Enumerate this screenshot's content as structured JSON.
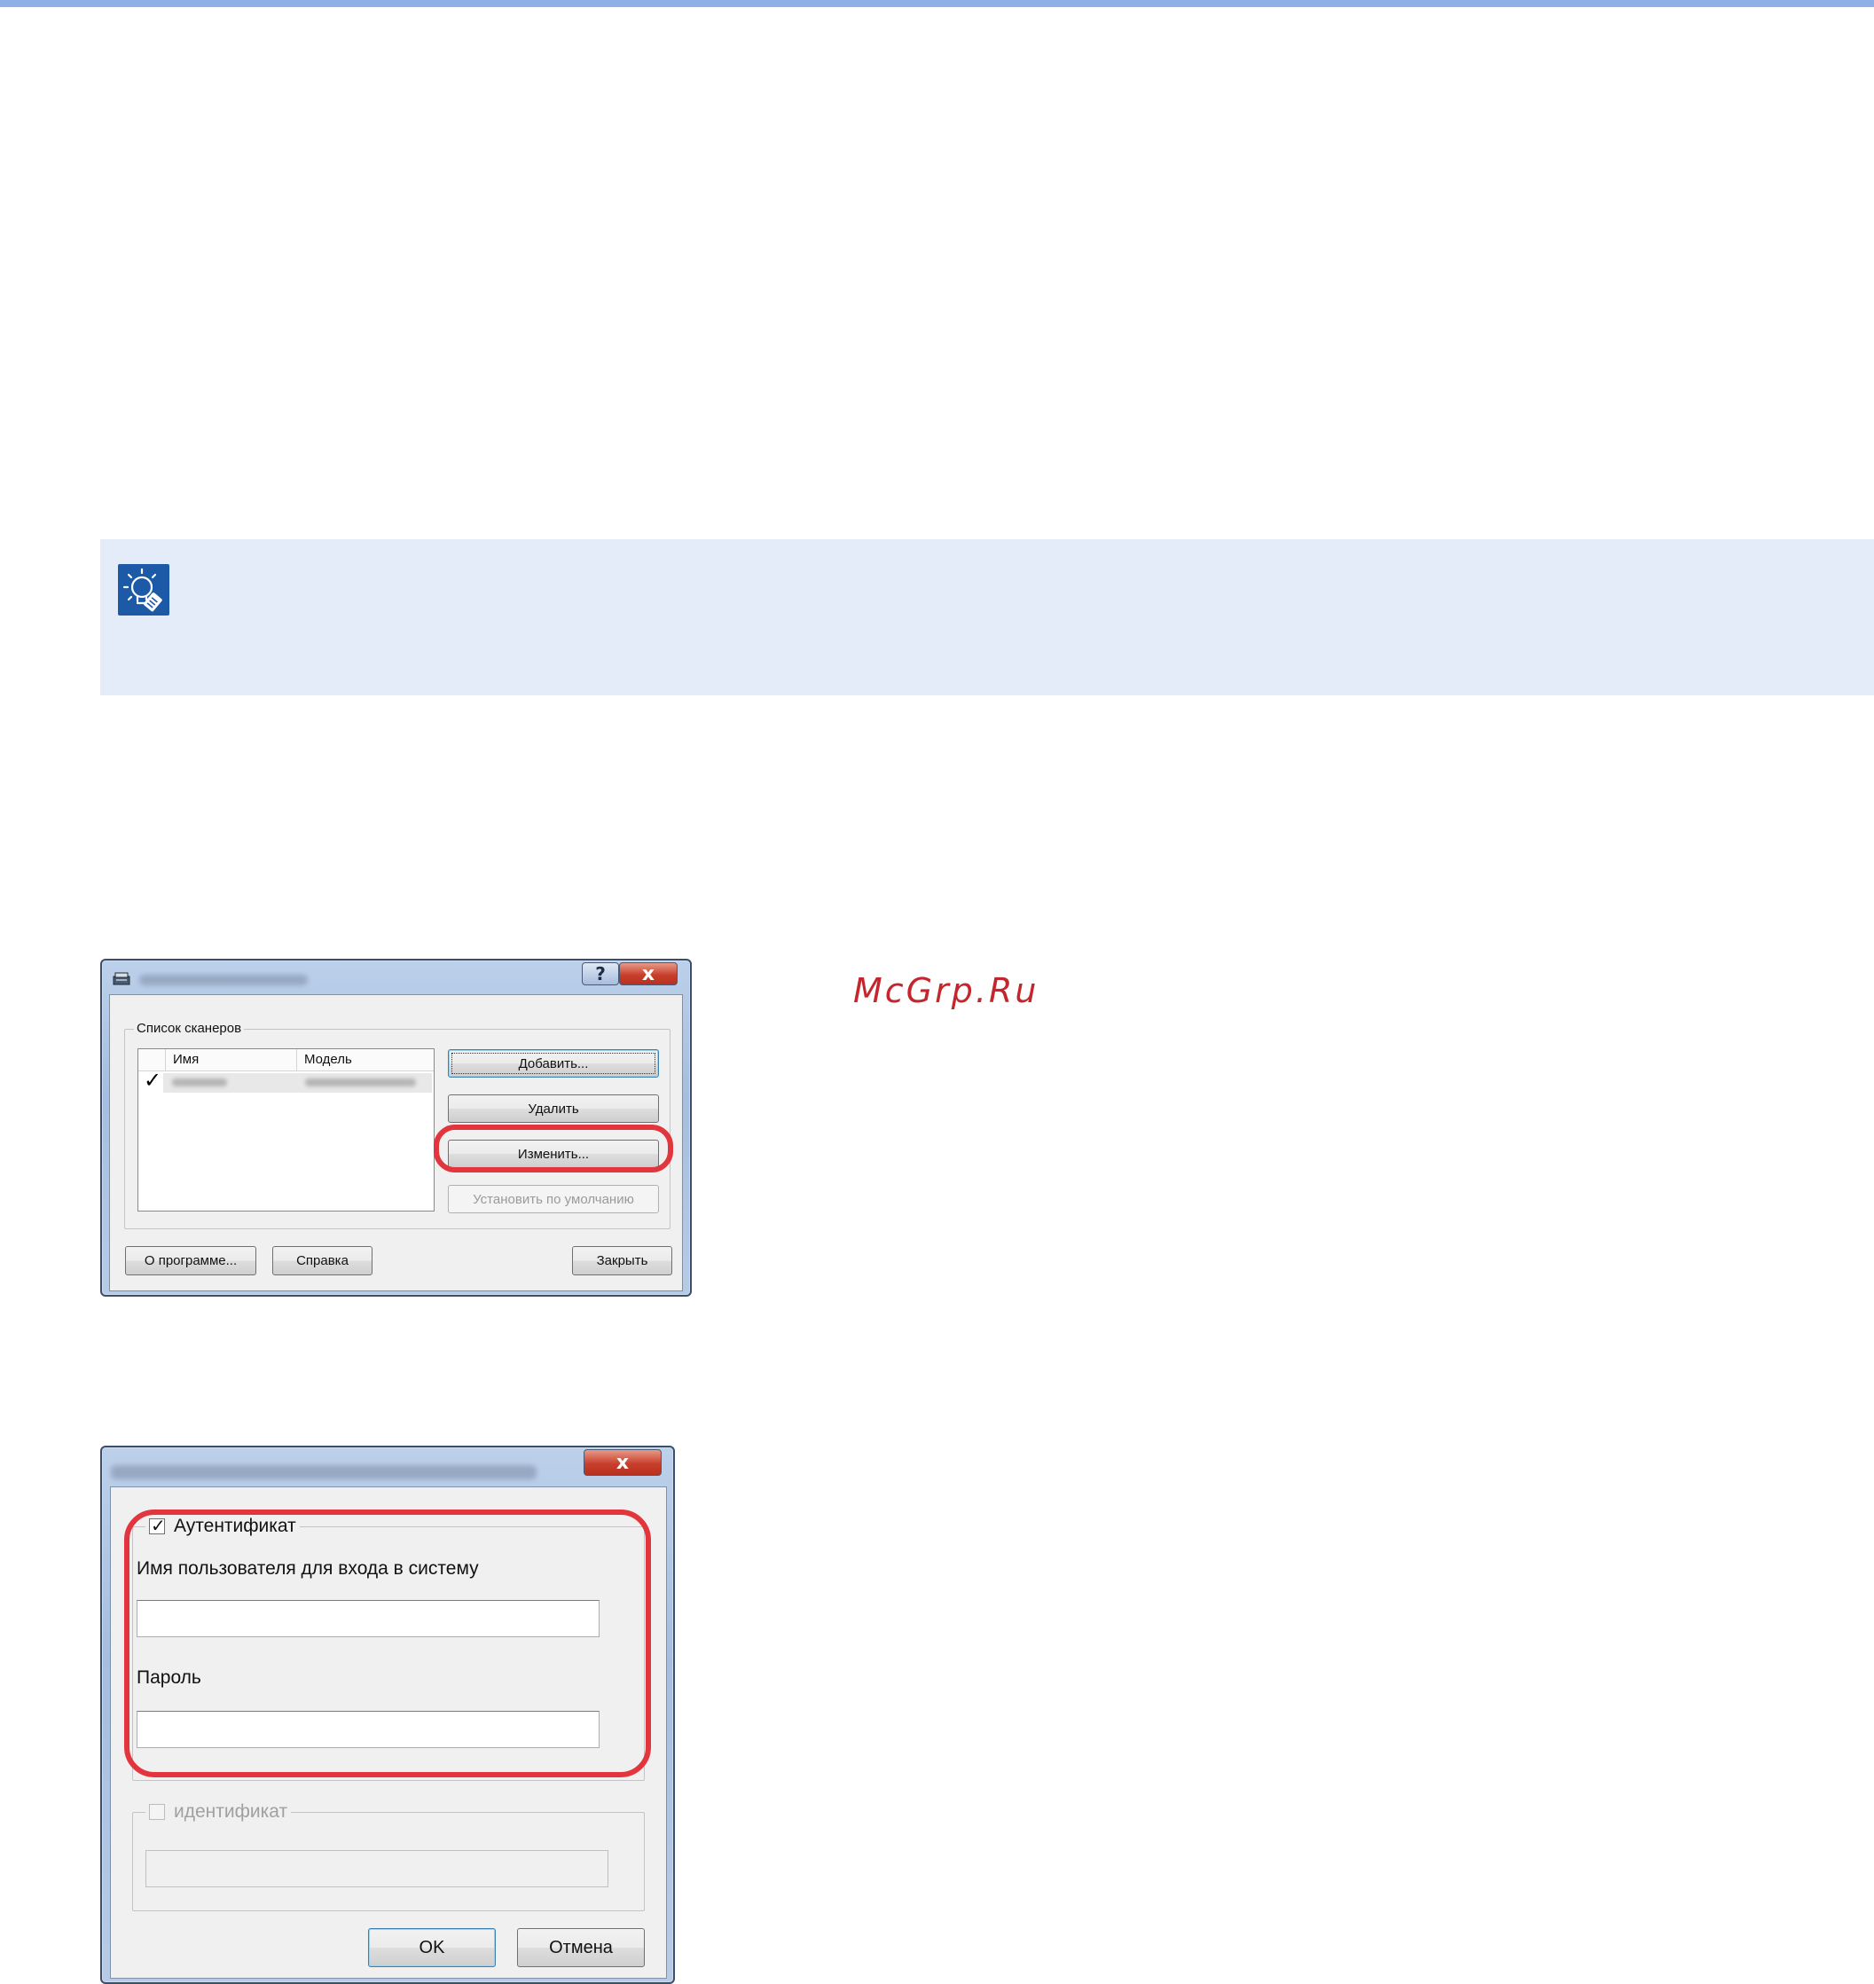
{
  "watermark": "McGrp.Ru",
  "colors": {
    "accent_bar": "#8eb0e6",
    "note_band": "#e4ecf9",
    "note_icon": "#1c5aa8",
    "highlight": "#e2353d"
  },
  "note": {
    "icon": "lightbulb-hint-icon"
  },
  "scanner_dialog": {
    "title_obscured": true,
    "help_button": "?",
    "close_button": "x",
    "group_title": "Список сканеров",
    "columns": [
      "Имя",
      "Модель"
    ],
    "rows": [
      {
        "checked": true,
        "checkmark": "✓",
        "name_obscured": true,
        "model_obscured": true
      }
    ],
    "buttons": {
      "add": "Добавить...",
      "delete": "Удалить",
      "edit": "Изменить...",
      "set_default": "Установить по умолчанию",
      "about": "О программе...",
      "help": "Справка",
      "close": "Закрыть"
    }
  },
  "auth_dialog": {
    "title_obscured": true,
    "close_button": "x",
    "auth_group": {
      "checked": true,
      "checkmark": "✓",
      "label": "Аутентификат"
    },
    "username_label": "Имя пользователя для входа в систему",
    "username_value": "",
    "password_label": "Пароль",
    "password_value": "",
    "id_group": {
      "checked": false,
      "label": "идентификат"
    },
    "id_value": "",
    "ok": "OK",
    "cancel": "Отмена"
  }
}
